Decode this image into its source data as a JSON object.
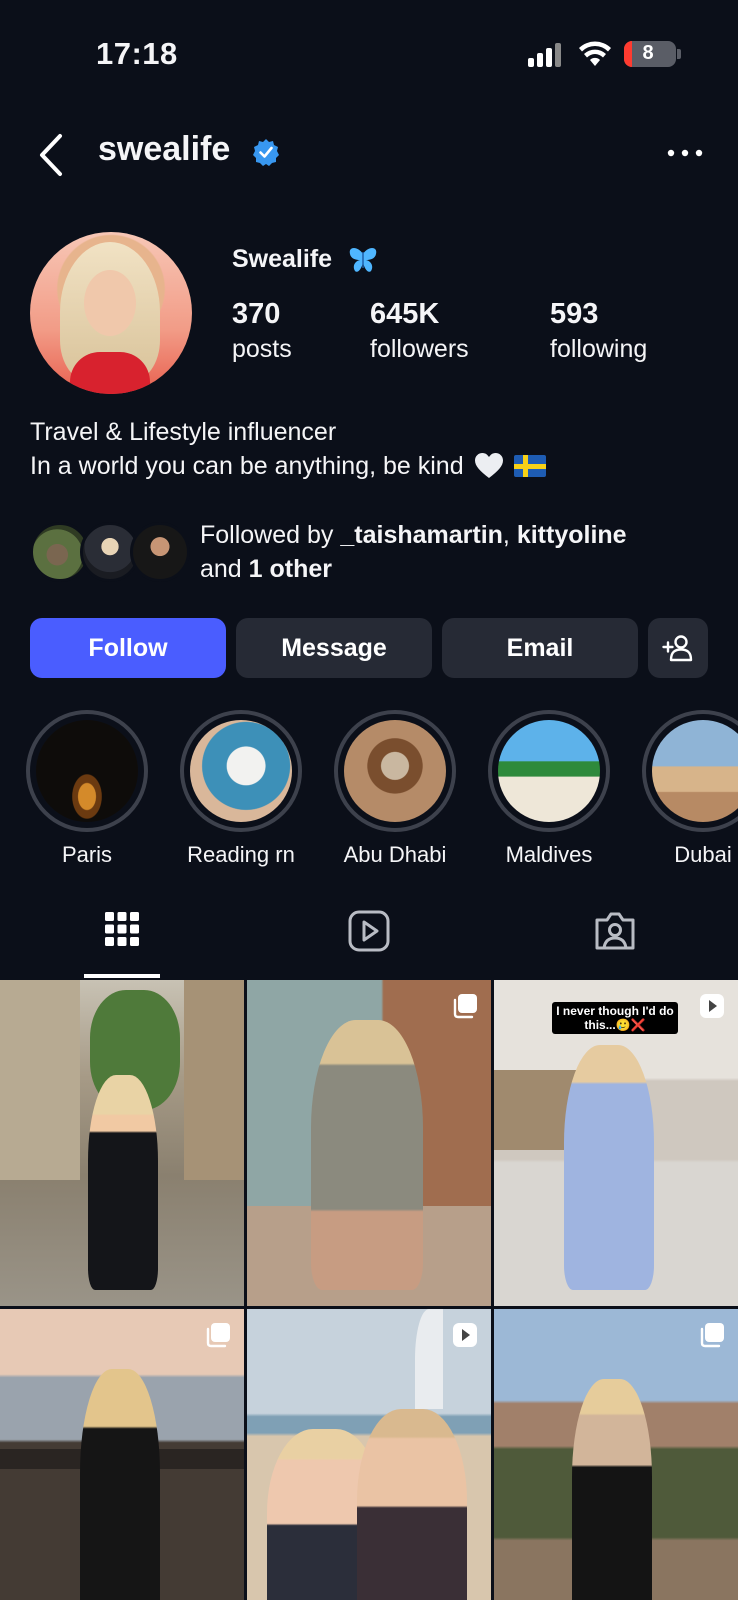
{
  "status_bar": {
    "time": "17:18",
    "battery": "8"
  },
  "header": {
    "username": "swealife"
  },
  "profile": {
    "display_name": "Swealife",
    "stats": [
      {
        "number": "370",
        "label": "posts"
      },
      {
        "number": "645K",
        "label": "followers"
      },
      {
        "number": "593",
        "label": "following"
      }
    ],
    "bio_line1": "Travel & Lifestyle influencer",
    "bio_line2": "In a world you can be anything, be kind"
  },
  "mutual": {
    "prefix": "Followed by ",
    "user1": "_taishamartin",
    "sep": ", ",
    "user2": "kittyoline",
    "and": "and ",
    "other": "1 other"
  },
  "actions": {
    "follow": "Follow",
    "message": "Message",
    "email": "Email"
  },
  "highlights": [
    "Paris",
    "Reading rn",
    "Abu Dhabi",
    "Maldives",
    "Dubai"
  ],
  "posts": [
    {
      "type": "photo"
    },
    {
      "type": "carousel"
    },
    {
      "type": "reel",
      "caption": "I never though I'd do this...🥲❌"
    },
    {
      "type": "carousel"
    },
    {
      "type": "reel"
    },
    {
      "type": "carousel"
    }
  ],
  "colors": {
    "background": "#0b0f19",
    "primary": "#4a5dff",
    "button": "#262a35",
    "verified": "#3897f0"
  }
}
